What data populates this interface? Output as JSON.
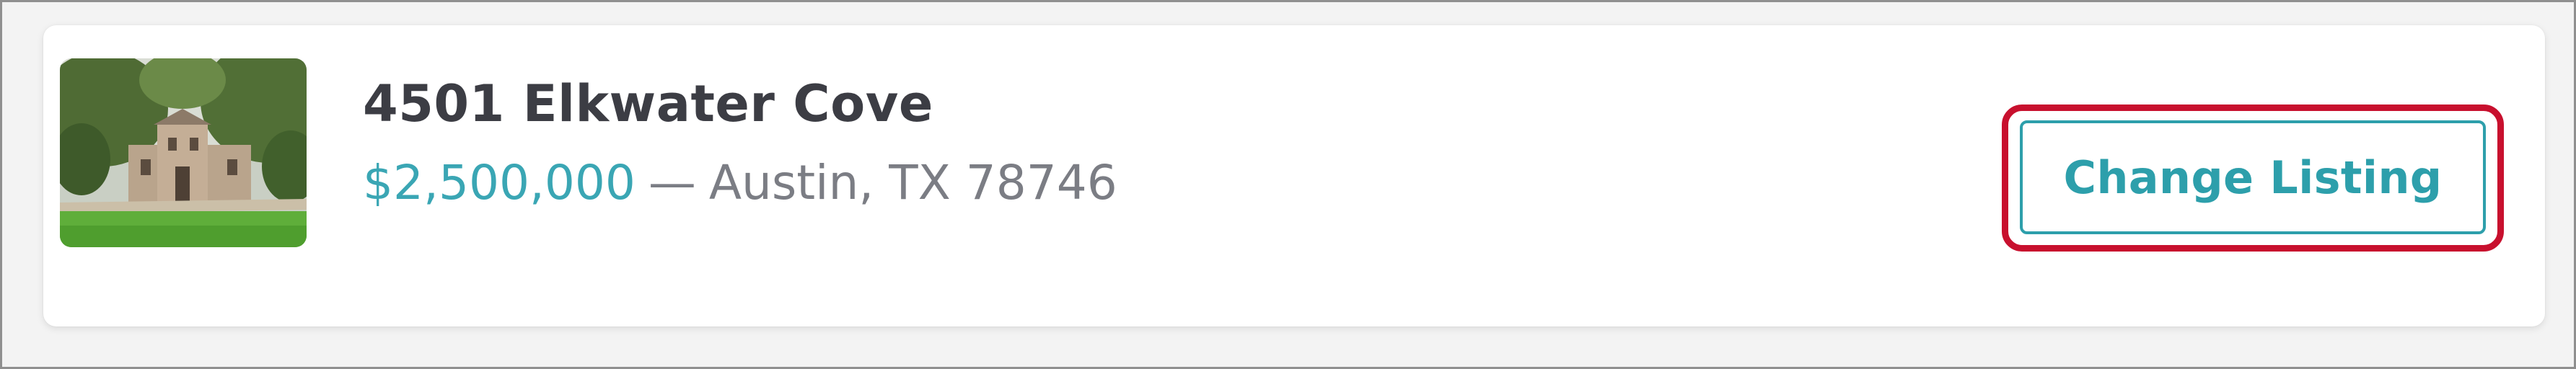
{
  "listing": {
    "address": "4501 Elkwater Cove",
    "price": "$2,500,000",
    "separator": "—",
    "location": "Austin, TX 78746",
    "thumbnail_icon": "house-photo"
  },
  "actions": {
    "change_listing_label": "Change Listing"
  },
  "colors": {
    "price": "#3aa6b4",
    "button": "#2d9fab",
    "highlight": "#c8102e",
    "title": "#3c3d44",
    "muted": "#7b7d84"
  }
}
